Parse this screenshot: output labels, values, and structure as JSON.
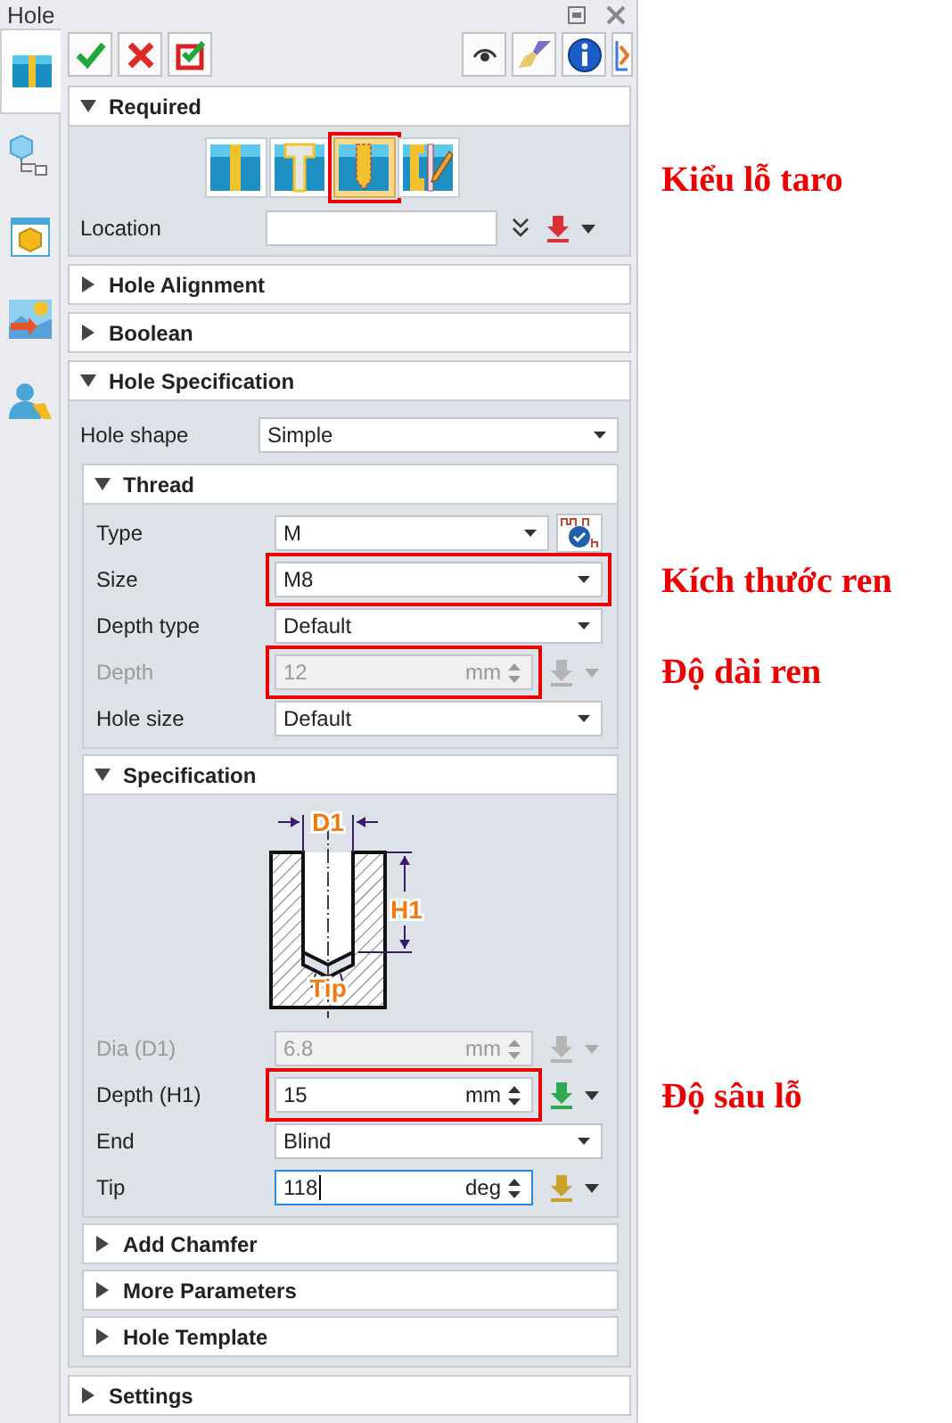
{
  "window": {
    "title": "Hole"
  },
  "side_tabs": [
    {
      "kind": "hole",
      "selected": true
    },
    {
      "kind": "tree",
      "selected": false
    },
    {
      "kind": "cube",
      "selected": false
    },
    {
      "kind": "image",
      "selected": false
    },
    {
      "kind": "user",
      "selected": false
    }
  ],
  "toolbar": {
    "left": [
      {
        "kind": "ok"
      },
      {
        "kind": "cancel"
      },
      {
        "kind": "apply"
      }
    ],
    "right": [
      {
        "kind": "eye"
      },
      {
        "kind": "brush"
      },
      {
        "kind": "info"
      },
      {
        "kind": "help"
      }
    ]
  },
  "sections": [
    {
      "title": "Required",
      "expanded": true,
      "hole_types": [
        {
          "kind": "simple",
          "selected": false,
          "highlighted": false
        },
        {
          "kind": "counterbore",
          "selected": false,
          "highlighted": false
        },
        {
          "kind": "tapped",
          "selected": true,
          "highlighted": true
        },
        {
          "kind": "custom",
          "selected": false,
          "highlighted": false
        }
      ],
      "rows": [
        {
          "label": "Location",
          "kind": "pick",
          "disabled": false,
          "pick": {
            "color": "#d9303a"
          }
        }
      ]
    },
    {
      "title": "Hole Alignment",
      "expanded": false
    },
    {
      "title": "Boolean",
      "expanded": false
    },
    {
      "title": "Hole Specification",
      "expanded": true,
      "rows": [
        {
          "label": "Hole shape",
          "kind": "dropdown",
          "value": "Simple",
          "disabled": false
        }
      ],
      "subsections": [
        {
          "title": "Thread",
          "expanded": true,
          "rows": [
            {
              "label": "Type",
              "kind": "dropdown",
              "value": "M",
              "disabled": false,
              "unit_toggle": true
            },
            {
              "label": "Size",
              "kind": "dropdown",
              "value": "M8",
              "disabled": false,
              "highlighted": true
            },
            {
              "label": "Depth type",
              "kind": "dropdown",
              "value": "Default",
              "disabled": false
            },
            {
              "label": "Depth",
              "kind": "number",
              "value": "12",
              "unit": "mm",
              "disabled": true,
              "highlighted": true,
              "pick": {
                "color": "#b4b4b4"
              }
            },
            {
              "label": "Hole size",
              "kind": "dropdown",
              "value": "Default",
              "disabled": false
            }
          ]
        },
        {
          "title": "Specification",
          "expanded": true,
          "diagram": {
            "labels": [
              "D1",
              "H1",
              "Tip"
            ]
          },
          "rows": [
            {
              "label": "Dia (D1)",
              "kind": "number",
              "value": "6.8",
              "unit": "mm",
              "disabled": true,
              "pick": {
                "color": "#b4b4b4"
              }
            },
            {
              "label": "Depth (H1)",
              "kind": "number",
              "value": "15",
              "unit": "mm",
              "disabled": false,
              "highlighted": true,
              "pick": {
                "color": "#2fa84f"
              }
            },
            {
              "label": "End",
              "kind": "dropdown",
              "value": "Blind",
              "disabled": false
            },
            {
              "label": "Tip",
              "kind": "number",
              "value": "118",
              "unit": "deg",
              "disabled": false,
              "focused": true,
              "pick": {
                "color": "#c9a227"
              }
            }
          ]
        },
        {
          "title": "Add Chamfer",
          "expanded": false
        },
        {
          "title": "More Parameters",
          "expanded": false
        },
        {
          "title": "Hole Template",
          "expanded": false
        }
      ]
    },
    {
      "title": "Settings",
      "expanded": false
    }
  ],
  "annotations": [
    {
      "text": "Kiểu lỗ taro"
    },
    {
      "text": "Kích thước ren"
    },
    {
      "text": "Độ dài ren"
    },
    {
      "text": "Độ sâu lỗ"
    }
  ]
}
